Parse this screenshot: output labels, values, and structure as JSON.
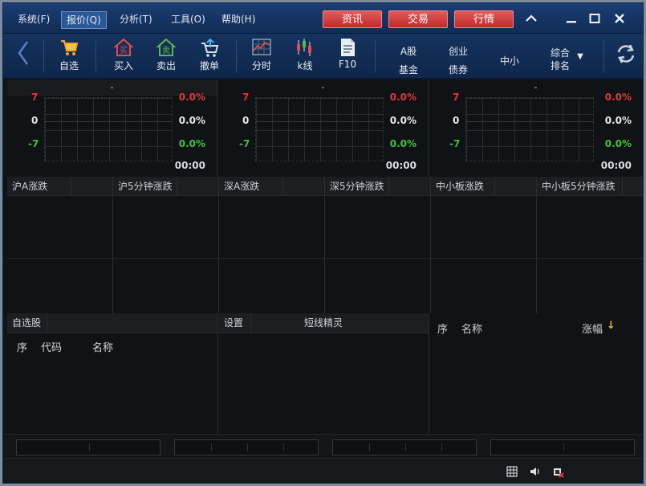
{
  "menu": [
    {
      "label": "系统(F)",
      "active": false
    },
    {
      "label": "报价(Q)",
      "active": true
    },
    {
      "label": "分析(T)",
      "active": false
    },
    {
      "label": "工具(O)",
      "active": false
    },
    {
      "label": "帮助(H)",
      "active": false
    }
  ],
  "top_buttons": {
    "news": "资讯",
    "trade": "交易",
    "market": "行情"
  },
  "window_controls": {
    "collapse": "^",
    "minimize": "—",
    "maximize": "☐",
    "close": "✕"
  },
  "toolbar": {
    "back": "‹",
    "watchlist": "自选",
    "buy": "买入",
    "sell": "卖出",
    "cancel": "撤单",
    "timeshare": "分时",
    "kline": "k线",
    "f10": "F10",
    "a_share": "A股",
    "fund": "基金",
    "chinext": "创业",
    "bond": "债券",
    "sme": "中小",
    "rank_top": "综合",
    "rank_bottom": "排名",
    "dropdown": "▼"
  },
  "index_panels": [
    {
      "title": "-",
      "y_top": "7",
      "y_mid": "0",
      "y_bot": "-7",
      "pct_top": "0.0%",
      "pct_mid": "0.0%",
      "pct_bot": "0.0%",
      "time": "00:00"
    },
    {
      "title": "-",
      "y_top": "7",
      "y_mid": "0",
      "y_bot": "-7",
      "pct_top": "0.0%",
      "pct_mid": "0.0%",
      "pct_bot": "0.0%",
      "time": "00:00"
    },
    {
      "title": "-",
      "y_top": "7",
      "y_mid": "0",
      "y_bot": "-7",
      "pct_top": "0.0%",
      "pct_mid": "0.0%",
      "pct_bot": "0.0%",
      "time": "00:00"
    }
  ],
  "rank_headers": [
    "沪A涨跌",
    "沪5分钟涨跌",
    "深A涨跌",
    "深5分钟涨跌",
    "中小板涨跌",
    "中小板5分钟涨跌"
  ],
  "watchlist_panel": {
    "tab": "自选股",
    "cols": {
      "seq": "序",
      "code": "代码",
      "name": "名称"
    }
  },
  "sprite_panel": {
    "settings": "设置",
    "title": "短线精灵"
  },
  "rank_panel": {
    "seq": "序",
    "name": "名称",
    "change": "涨幅",
    "sort_icon": "↓"
  }
}
